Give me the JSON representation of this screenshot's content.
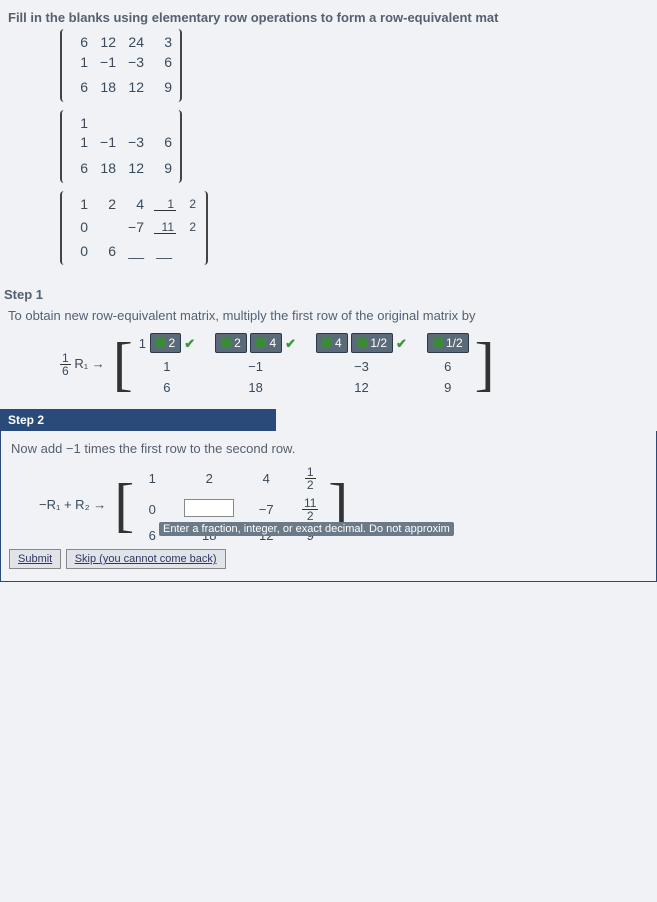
{
  "instruction": "Fill in the blanks using elementary row operations to form a row-equivalent mat",
  "matrices": {
    "m1": [
      [
        "6",
        "12",
        "24",
        "3"
      ],
      [
        "1",
        "−1",
        "−3",
        "6"
      ],
      [
        "6",
        "18",
        "12",
        "9"
      ]
    ],
    "m2": [
      [
        "1",
        "",
        "",
        ""
      ],
      [
        "1",
        "−1",
        "−3",
        "6"
      ],
      [
        "6",
        "18",
        "12",
        "9"
      ]
    ],
    "m3_r1": [
      "1",
      "2",
      "4"
    ],
    "m3_r1_frac": {
      "n": "1",
      "d": "2"
    },
    "m3_r2_a": "0",
    "m3_r2_b": "−7",
    "m3_r2_frac": {
      "n": "11",
      "d": "2"
    },
    "m3_r3": [
      "0",
      "6",
      "",
      ""
    ]
  },
  "step1": {
    "heading": "Step 1",
    "text": "To obtain new row-equivalent matrix, multiply the first row of the original matrix by",
    "op_frac": {
      "n": "1",
      "d": "6"
    },
    "op_tail": "R₁ →",
    "row1_first": "1",
    "answers": [
      "2",
      "2",
      "4",
      "4",
      "1/2",
      "1/2"
    ],
    "row2": [
      "1",
      "−1",
      "−3",
      "6"
    ],
    "row3": [
      "6",
      "18",
      "12",
      "9"
    ]
  },
  "step2": {
    "bar": "Step 2",
    "text": "Now add −1 times the first row to the second row.",
    "op": "−R₁ + R₂ →",
    "row1": [
      "1",
      "2",
      "4"
    ],
    "row1_frac": {
      "n": "1",
      "d": "2"
    },
    "row2_a": "0",
    "row2_b": "−7",
    "row2_frac": {
      "n": "11",
      "d": "2"
    },
    "row3": [
      "6",
      "18",
      "12",
      "9"
    ],
    "hint": "Enter a fraction, integer, or exact decimal. Do not approxim"
  },
  "buttons": {
    "submit": "Submit",
    "skip": "Skip (you cannot come back)"
  }
}
